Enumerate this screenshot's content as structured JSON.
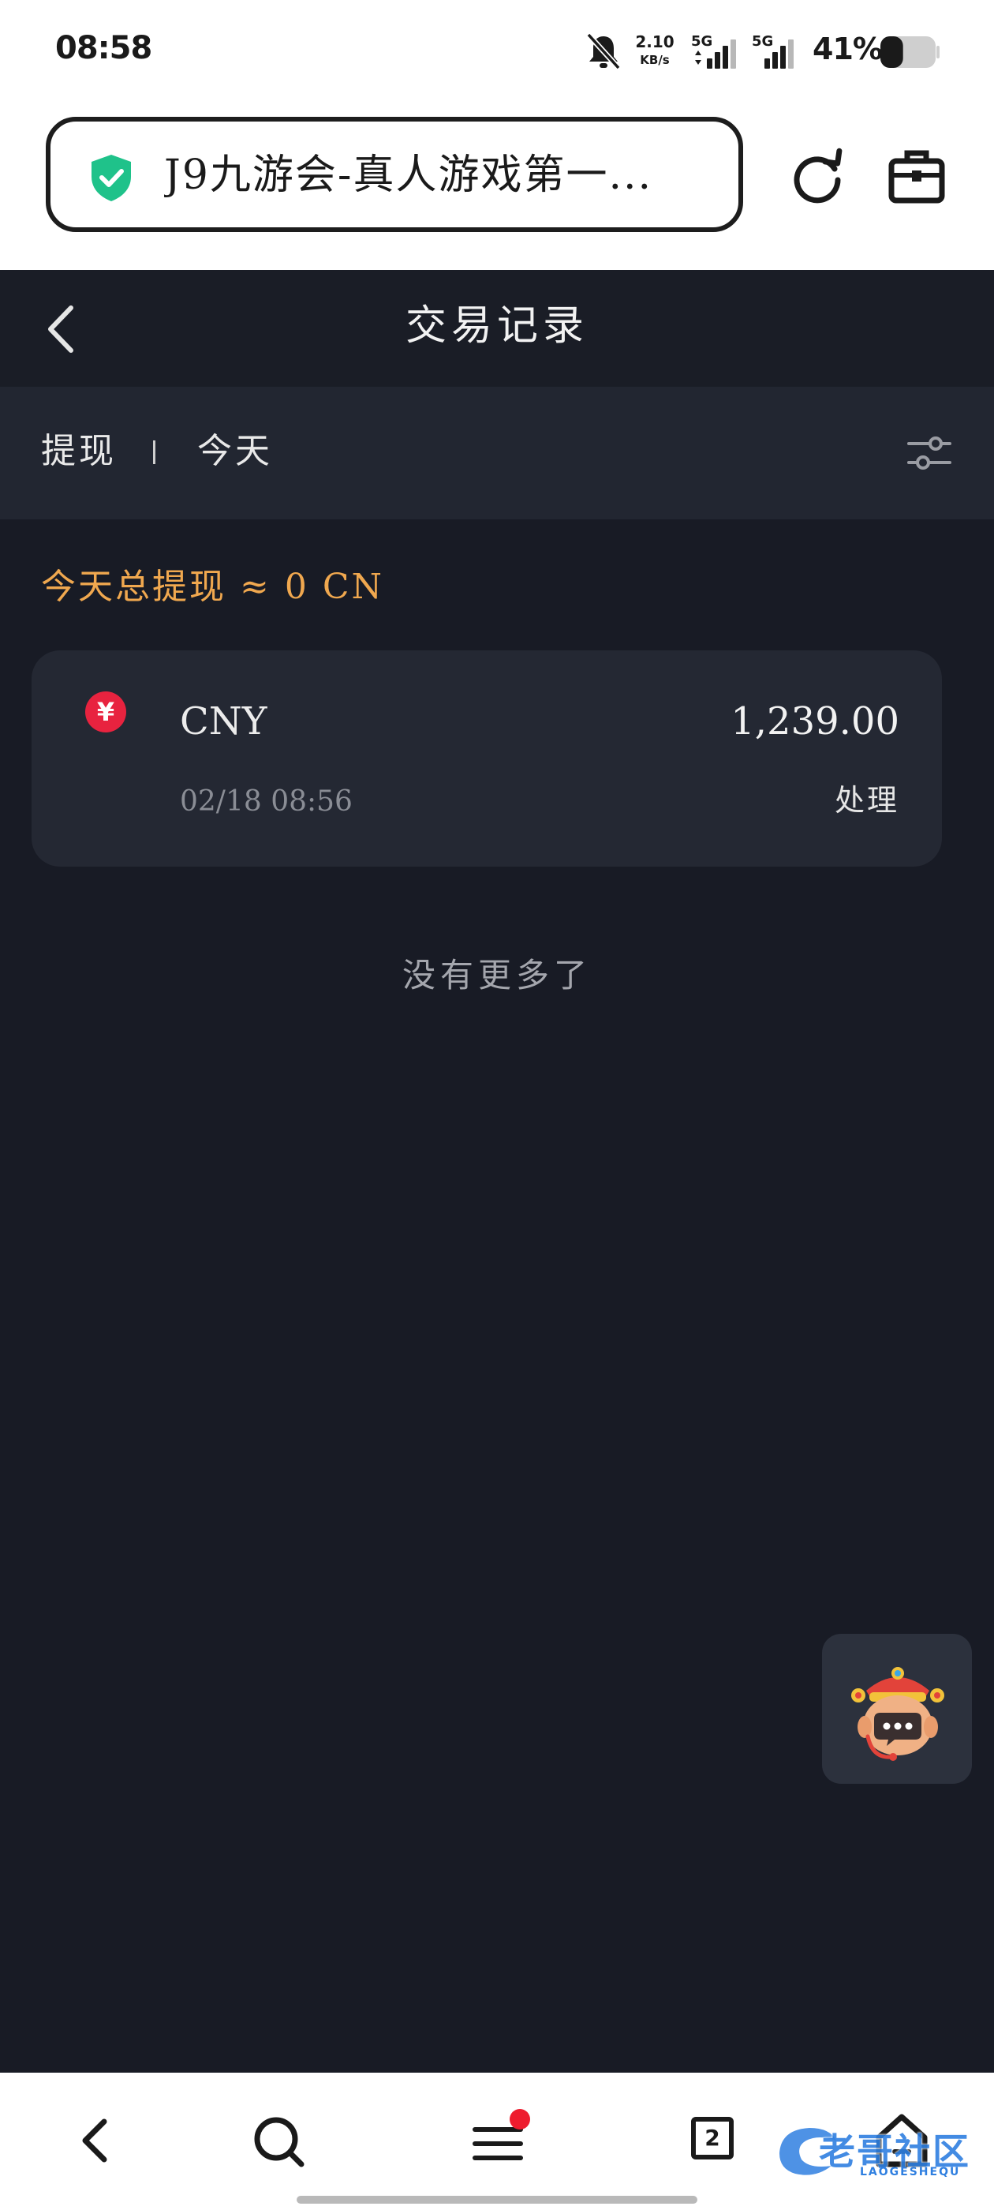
{
  "status_bar": {
    "time": "08:58",
    "net_speed_value": "2.10",
    "net_speed_unit": "KB/s",
    "signal1_label": "5G",
    "signal2_label": "5G",
    "battery_percent": "41%",
    "battery_level": 0.41
  },
  "browser": {
    "url_title": "J9九游会-真人游戏第一...",
    "tab_count": "2"
  },
  "header": {
    "title": "交易记录"
  },
  "filter": {
    "type": "提现",
    "date": "今天"
  },
  "summary": {
    "text": "今天总提现 ≈ 0 CN"
  },
  "transactions": [
    {
      "currency_symbol": "¥",
      "currency": "CNY",
      "amount": "1,239.00",
      "time": "02/18 08:56",
      "status": "处理"
    }
  ],
  "list_footer": "没有更多了",
  "watermark": {
    "text": "老哥社区",
    "sub": "LAOGESHEQU"
  },
  "colors": {
    "page_bg": "#181b25",
    "card_bg": "#242833",
    "accent_orange": "#f0a84f",
    "currency_badge": "#e8233f",
    "secure_green": "#1fc28a",
    "notification_dot": "#ee1c2e"
  }
}
